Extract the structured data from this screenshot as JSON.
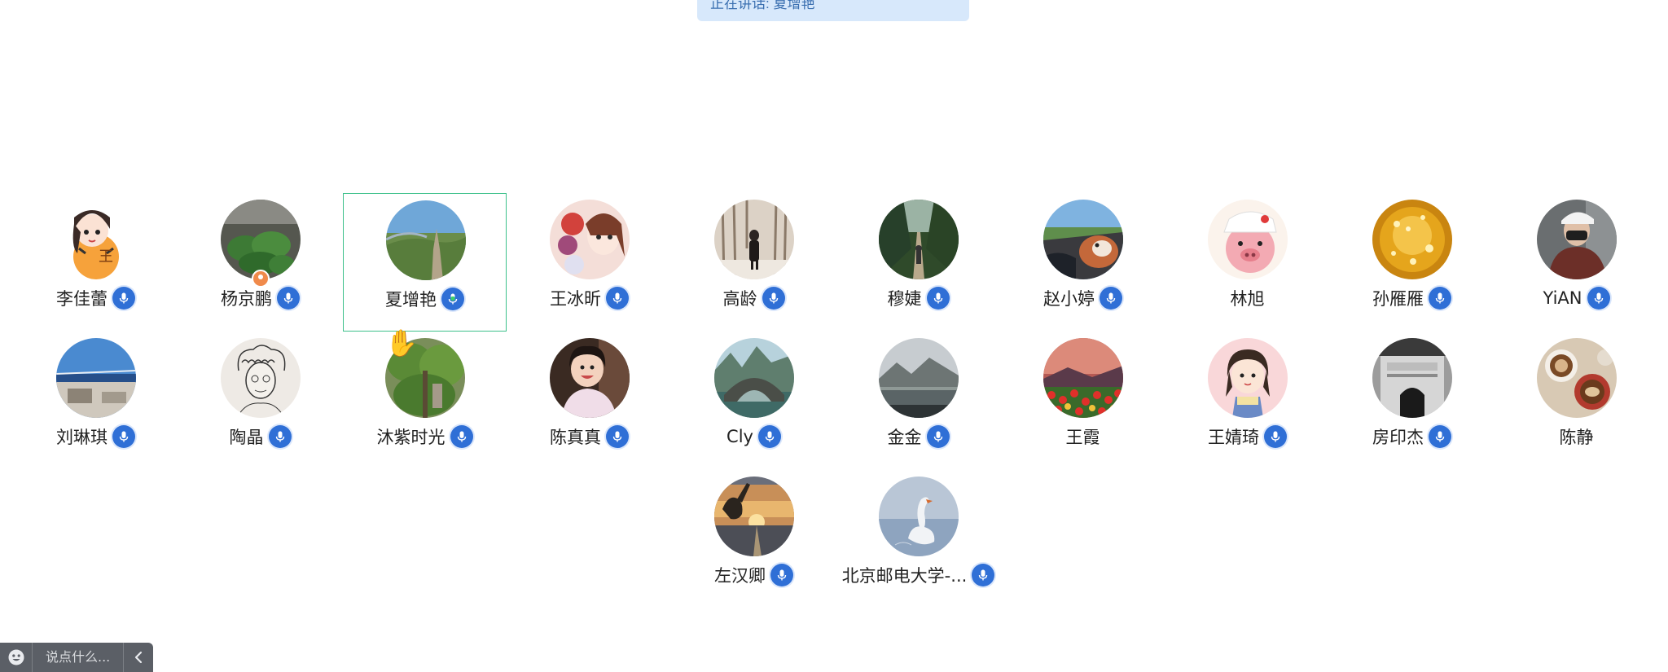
{
  "banner": {
    "speaking_text": "正在讲话: 夏增艳"
  },
  "participants": [
    {
      "name": "李佳蕾",
      "mic": true,
      "avatar": "cartoon-girl-tiger"
    },
    {
      "name": "杨京鹏",
      "mic": true,
      "avatar": "green-leaves",
      "host": true
    },
    {
      "name": "夏增艳",
      "mic": true,
      "speaking": true,
      "active": true,
      "avatar": "great-wall"
    },
    {
      "name": "王冰昕",
      "mic": true,
      "avatar": "anime-flowers"
    },
    {
      "name": "高龄",
      "mic": true,
      "avatar": "winter-forest"
    },
    {
      "name": "穆婕",
      "mic": true,
      "avatar": "tree-path"
    },
    {
      "name": "赵小婷",
      "mic": true,
      "avatar": "car-dog"
    },
    {
      "name": "林旭",
      "mic": false,
      "avatar": "pink-pig"
    },
    {
      "name": "孙雁雁",
      "mic": true,
      "avatar": "golden-sparkles"
    },
    {
      "name": "YiAN",
      "mic": true,
      "avatar": "person-mask"
    },
    {
      "name": "刘琳琪",
      "mic": true,
      "avatar": "beach-sky"
    },
    {
      "name": "陶晶",
      "mic": true,
      "avatar": "sketch-curly-hair"
    },
    {
      "name": "沐紫时光",
      "mic": true,
      "raised_hand": true,
      "avatar": "bamboo-forest"
    },
    {
      "name": "陈真真",
      "mic": true,
      "avatar": "smiling-girl"
    },
    {
      "name": "Cly",
      "mic": true,
      "avatar": "stone-bridge"
    },
    {
      "name": "金金",
      "mic": true,
      "avatar": "mountain-lake"
    },
    {
      "name": "王霞",
      "mic": false,
      "avatar": "tulip-sunset"
    },
    {
      "name": "王婧琦",
      "mic": true,
      "avatar": "cartoon-girl-pink"
    },
    {
      "name": "房印杰",
      "mic": true,
      "avatar": "bw-gate"
    },
    {
      "name": "陈静",
      "mic": false,
      "avatar": "coffee-cups"
    },
    {
      "name": "左汉卿",
      "mic": true,
      "avatar": "sunset-hand"
    },
    {
      "name": "北京邮电大学-...",
      "mic": true,
      "avatar": "swan-lake"
    }
  ],
  "chat": {
    "placeholder": "说点什么..."
  },
  "colors": {
    "accent": "#2f6fd6",
    "active_border": "#3cc08a",
    "banner_bg": "#d7e8fb"
  }
}
